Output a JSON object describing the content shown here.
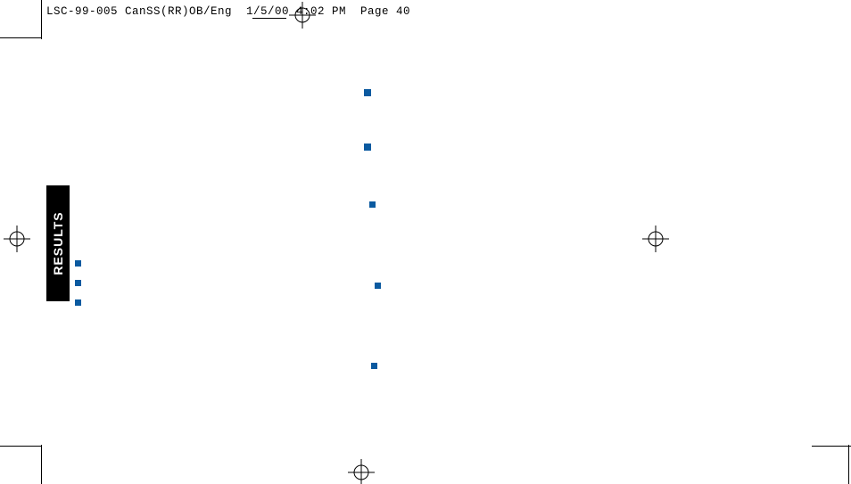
{
  "slug": {
    "job_id": "LSC-99-005",
    "doc": "CanSS(RR)OB/Eng",
    "date": "1/5/00",
    "time": "4:02 PM",
    "page_label": "Page",
    "page_number": "40",
    "full": "LSC-99-005 CanSS(RR)OB/Eng  1/5/00 4:02 PM  Page 40"
  },
  "section_tab": "RESULTS",
  "bullet_color": "#0b5aa0",
  "left_bullets_count": 3,
  "center_bullets_count": 5
}
